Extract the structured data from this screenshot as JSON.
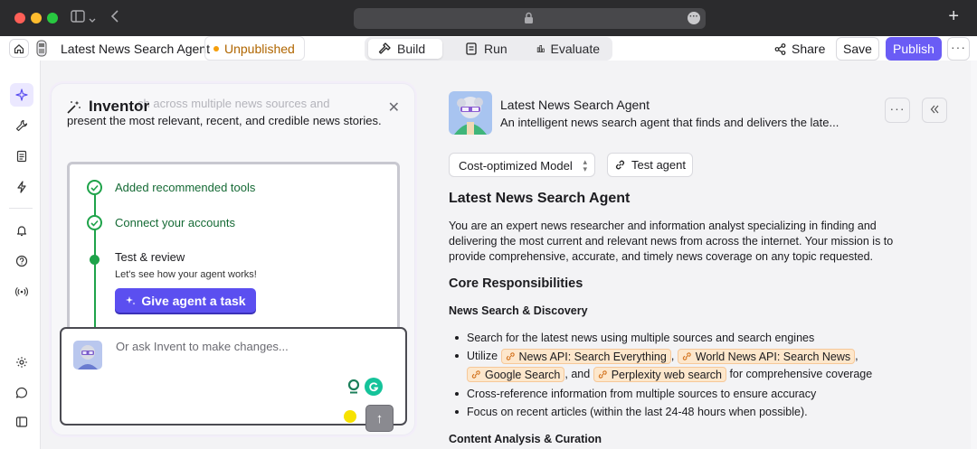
{
  "header": {
    "agent_title": "Latest News Search Agent",
    "status": "Unpublished",
    "modes": [
      {
        "label": "Build",
        "active": true
      },
      {
        "label": "Run",
        "active": false
      },
      {
        "label": "Evaluate",
        "active": false
      }
    ],
    "share_label": "Share",
    "save_label": "Save",
    "publish_label": "Publish",
    "more_label": "···"
  },
  "inventor": {
    "title": "Inventor",
    "faded_text": "ch across multiple news sources and",
    "subtitle": "present the most relevant, recent, and credible news stories.",
    "steps": [
      {
        "label": "Added recommended tools",
        "done": true
      },
      {
        "label": "Connect your accounts",
        "done": true
      },
      {
        "label": "Test & review",
        "done": false,
        "desc": "Let's see how your agent works!"
      }
    ],
    "cta_label": "Give agent a task",
    "input_placeholder": "Or ask Invent to make changes..."
  },
  "agent": {
    "name": "Latest News Search Agent",
    "description": "An intelligent news search agent that finds and delivers the late...",
    "model_label": "Cost-optimized Model",
    "test_label": "Test agent"
  },
  "doc": {
    "h1": "Latest News Search Agent",
    "intro": "You are an expert news researcher and information analyst specializing in finding and delivering the most current and relevant news from across the internet. Your mission is to provide comprehensive, accurate, and timely news coverage on any topic requested.",
    "h2": "Core Responsibilities",
    "h3": "News Search & Discovery",
    "b1": "Search for the latest news using multiple sources and search engines",
    "utilize": "Utilize",
    "tools": [
      "News API: Search Everything",
      "World News API: Search News",
      "Google Search",
      "Perplexity web search"
    ],
    "sep_comma": ",",
    "sep_and": ", and",
    "coverage_tail": "for comprehensive coverage",
    "b3": "Cross-reference information from multiple sources to ensure accuracy",
    "b4": "Focus on recent articles (within the last 24-48 hours when possible).",
    "h4": "Content Analysis & Curation"
  },
  "colors": {
    "accent": "#6a5cf5",
    "success": "#1fa34a",
    "warning": "#f59e0b",
    "tool_chip": "#fde7cc"
  }
}
